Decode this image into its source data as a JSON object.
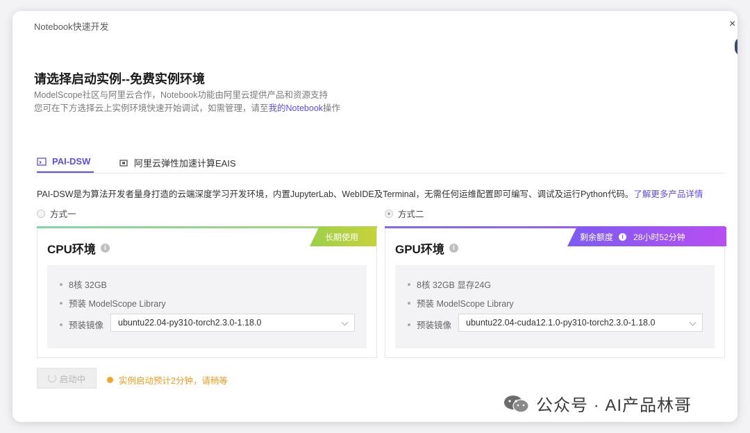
{
  "dialog": {
    "title": "Notebook快速开发",
    "close_glyph": "×"
  },
  "header": {
    "heading": "请选择启动实例--免费实例环境",
    "line1": "ModelScope社区与阿里云合作，Notebook功能由阿里云提供产品和资源支持",
    "line2_prefix": "您可在下方选择云上实例环境快速开始调试，如需管理，请至",
    "line2_link": "我的Notebook",
    "line2_suffix": "操作"
  },
  "tabs": [
    {
      "label": "PAI-DSW",
      "icon": "dsw-icon",
      "active": true
    },
    {
      "label": "阿里云弹性加速计算EAIS",
      "icon": "chip-icon",
      "active": false
    }
  ],
  "intro": {
    "text": "PAI-DSW是为算法开发者量身打造的云端深度学习开发环境，内置JupyterLab、WebIDE及Terminal，无需任何运维配置即可编写、调试及运行Python代码。",
    "link": "了解更多产品详情"
  },
  "options": [
    {
      "radio_label": "方式一",
      "checked": false,
      "title": "CPU环境",
      "ribbon": "长期使用",
      "specs": [
        "8核 32GB",
        "预装 ModelScope Library"
      ],
      "image_label": "预装镜像",
      "image_value": "ubuntu22.04-py310-torch2.3.0-1.18.0"
    },
    {
      "radio_label": "方式二",
      "checked": true,
      "title": "GPU环境",
      "ribbon_label": "剩余额度",
      "ribbon_value": "28小时52分钟",
      "specs": [
        "8核 32GB 显存24G",
        "预装 ModelScope Library"
      ],
      "image_label": "预装镜像",
      "image_value": "ubuntu22.04-cuda12.1.0-py310-torch2.3.0-1.18.0"
    }
  ],
  "footer": {
    "start_button": "启动中",
    "status": "实例启动预计2分钟，请稍等"
  },
  "watermark": {
    "text": "公众号 · AI产品林哥"
  },
  "colors": {
    "accent": "#5b4ef0",
    "cpu_ribbon": "#8dc63f",
    "gpu_ribbon": "#a04cf0",
    "status": "#f39b1c"
  }
}
